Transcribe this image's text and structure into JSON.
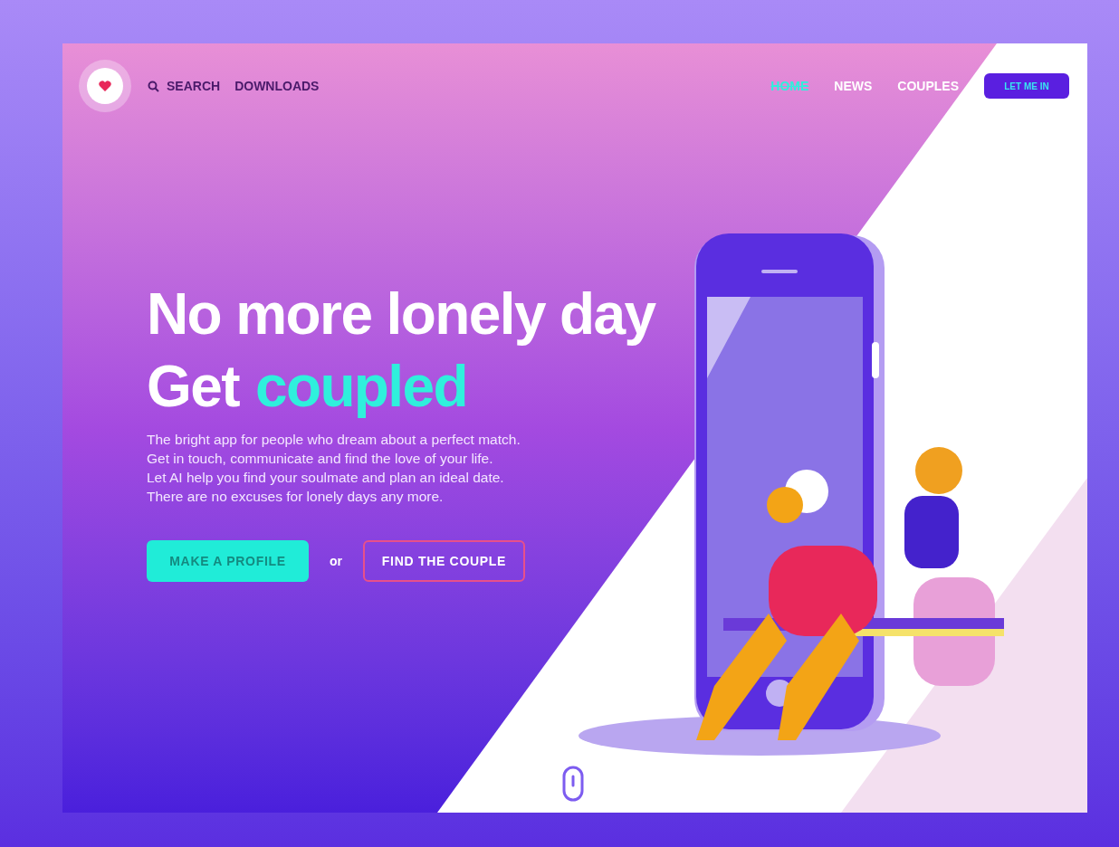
{
  "header": {
    "nav_left": [
      {
        "label": "SEARCH",
        "kind": "search"
      },
      {
        "label": "DOWNLOADS",
        "kind": "plain"
      }
    ],
    "nav_right": [
      {
        "label": "HOME",
        "selected": true
      },
      {
        "label": "NEWS",
        "selected": false
      },
      {
        "label": "COUPLES",
        "selected": false
      }
    ],
    "login_button": "LET ME IN"
  },
  "hero": {
    "headline_line1": "No more lonely day",
    "headline_line2_plain": "Get",
    "headline_line2_accent": "coupled",
    "description": [
      "The bright app for people who dream about a perfect match.",
      "Get in touch, communicate and find the love of your life.",
      "Let AI help you find your soulmate and plan an ideal date.",
      "There are no excuses for lonely days any more."
    ],
    "primary_button": "MAKE A PROFILE",
    "separator": "or",
    "secondary_button": "FIND THE COUPLE"
  }
}
